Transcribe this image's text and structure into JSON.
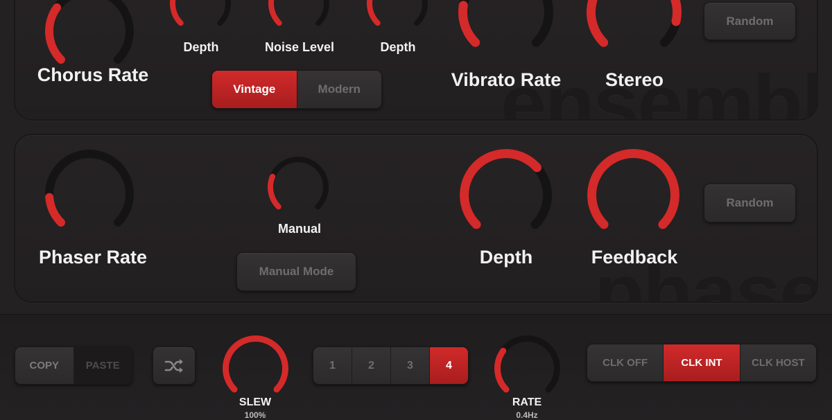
{
  "colors": {
    "accent": "#d42a2a",
    "track": "#151415",
    "background": "#232122"
  },
  "ensemble": {
    "watermark": "ensemble",
    "chorus_rate": {
      "label": "Chorus Rate",
      "value": 0.3
    },
    "chorus_depth": {
      "label": "Depth",
      "value": 0.28
    },
    "noise_level": {
      "label": "Noise Level",
      "value": 0.22
    },
    "vibrato_depth": {
      "label": "Depth",
      "value": 0.24
    },
    "vibrato_rate": {
      "label": "Vibrato Rate",
      "value": 0.2
    },
    "stereo": {
      "label": "Stereo",
      "value": 0.88
    },
    "mode": {
      "options": [
        "Vintage",
        "Modern"
      ],
      "selected": "Vintage"
    },
    "random_label": "Random"
  },
  "phaser": {
    "watermark": "phaser",
    "phaser_rate": {
      "label": "Phaser Rate",
      "value": 0.15
    },
    "manual": {
      "label": "Manual",
      "value": 0.25
    },
    "depth": {
      "label": "Depth",
      "value": 0.68
    },
    "feedback": {
      "label": "Feedback",
      "value": 1.0
    },
    "manual_mode_label": "Manual Mode",
    "random_label": "Random"
  },
  "bottom": {
    "copy_label": "COPY",
    "paste_label": "PASTE",
    "shuffle_icon": "shuffle-icon",
    "slew": {
      "label": "SLEW",
      "value_text": "100%",
      "value": 1.0
    },
    "pages": {
      "options": [
        "1",
        "2",
        "3",
        "4"
      ],
      "selected": "4"
    },
    "rate": {
      "label": "RATE",
      "value_text": "0.4Hz",
      "value": 0.3
    },
    "clock": {
      "options": [
        "CLK OFF",
        "CLK INT",
        "CLK HOST"
      ],
      "selected": "CLK INT"
    }
  }
}
